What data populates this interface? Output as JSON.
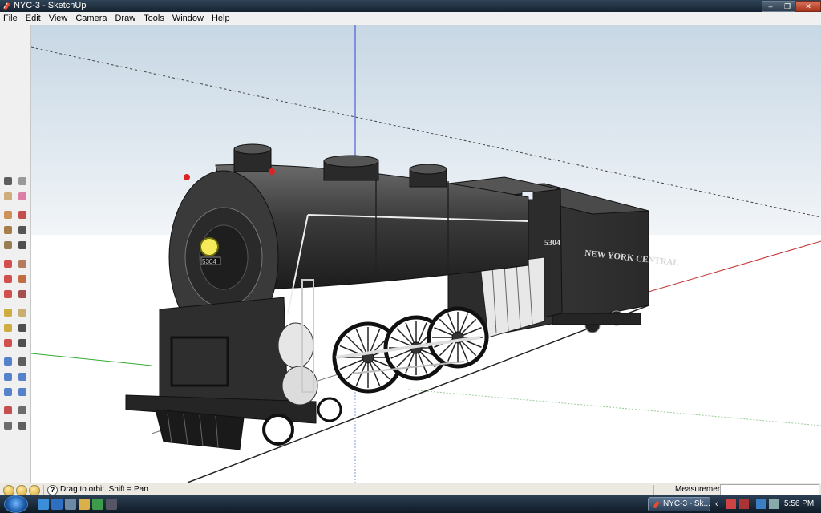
{
  "window": {
    "title": "NYC-3 - SketchUp",
    "buttons": {
      "minimize": "–",
      "maximize": "❐",
      "close": "✕"
    }
  },
  "menu": [
    "File",
    "Edit",
    "View",
    "Camera",
    "Draw",
    "Tools",
    "Window",
    "Help"
  ],
  "toolbar": {
    "tools": [
      "select-icon",
      "make-component-icon",
      "paint-bucket-icon",
      "eraser-icon",
      "rectangle-icon",
      "line-icon",
      "circle-icon",
      "arc-icon",
      "polygon-icon",
      "freehand-icon",
      "move-icon",
      "push-pull-icon",
      "rotate-icon",
      "follow-me-icon",
      "scale-icon",
      "offset-icon",
      "tape-measure-icon",
      "dimension-icon",
      "protractor-icon",
      "text-icon",
      "axes-icon",
      "3d-text-icon",
      "orbit-icon",
      "pan-icon",
      "zoom-icon",
      "zoom-window-icon",
      "previous-view-icon",
      "zoom-extents-icon",
      "position-camera-icon",
      "look-around-icon",
      "walk-icon",
      "section-plane-icon"
    ]
  },
  "model": {
    "number_plate": "5304",
    "cab_number": "5304",
    "tender_lettering": "NEW YORK CENTRAL"
  },
  "statusbar": {
    "hint": "Drag to orbit.  Shift = Pan",
    "help_glyph": "?",
    "measurements_label": "Measurements",
    "measurements_value": ""
  },
  "taskbar": {
    "task_label": "NYC-3 - Sk...",
    "clock": "5:56 PM"
  },
  "colors": {
    "axis_blue": "#3344cc",
    "axis_red": "#c33333",
    "axis_green": "#33aa33",
    "sky_top": "#c7d7e4",
    "ground": "#ffffff"
  }
}
